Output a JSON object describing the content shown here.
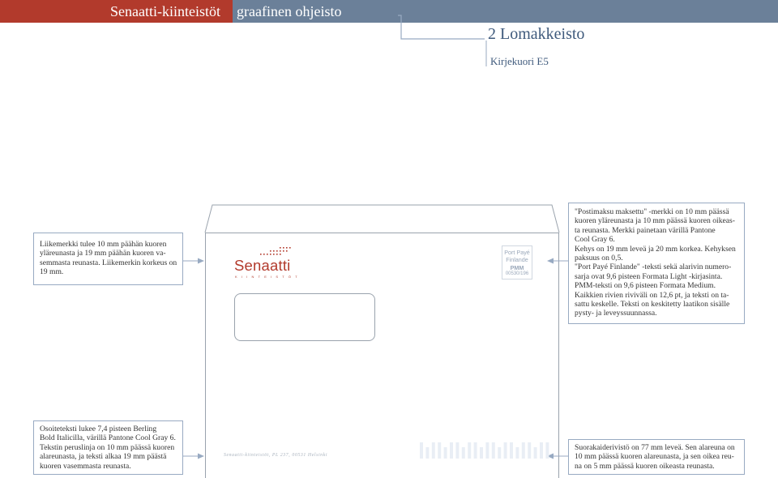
{
  "header": {
    "title_brand": "Senaatti-kiinteistöt",
    "title_rest": "graafinen ohjeisto",
    "colors": {
      "red": "#b23a2c",
      "blue": "#6b8099"
    }
  },
  "section": {
    "title": "2 Lomakkeisto",
    "subtitle": "Kirjekuori E5"
  },
  "annotations": {
    "logo": {
      "lines": [
        "Liikemerkki tulee 10 mm päähän kuoren",
        "yläreunasta ja 19 mm päähän kuoren va-",
        "semmasta reunasta. Liikemerkin korkeus on",
        "19 mm."
      ]
    },
    "postage": {
      "lines": [
        "\"Postimaksu maksettu\" -merkki on 10 mm päässä",
        "kuoren yläreunasta ja 10 mm päässä kuoren oikeas-",
        "ta reunasta.  Merkki painetaan värillä Pantone",
        "Cool Gray 6.",
        "Kehys on 19 mm leveä ja 20 mm korkea. Kehyksen",
        "paksuus on 0,5.",
        "\"Port Payé Finlande\" -teksti sekä alarivin numero-",
        "sarja ovat 9,6 pisteen Formata Light -kirjasinta.",
        "PMM-teksti on 9,6 pisteen Formata Medium.",
        "Kaikkien rivien riviväli on 12,6 pt, ja teksti on ta-",
        "sattu keskelle. Teksti on keskitetty laatikon sisälle",
        "pysty- ja leveyssuunnassa."
      ]
    },
    "address": {
      "lines": [
        "Osoiteteksti lukee 7,4 pisteen Berling",
        "Bold Italicilla, värillä Pantone Cool Gray 6.",
        "Tekstin peruslinja on 10 mm päässä kuoren",
        "alareunasta, ja teksti alkaa 19 mm päästä",
        "kuoren vasemmasta reunasta."
      ]
    },
    "barcode": {
      "lines": [
        "Suorakaiderivistö on 77 mm leveä. Sen alareuna on",
        "10 mm päässä kuoren alareunasta, ja sen oikea reu-",
        "na on 5 mm päässä kuoren oikeasta reunasta."
      ]
    }
  },
  "envelope": {
    "logo": {
      "name": "Senaatti",
      "subline": "KIINTEISTÖT"
    },
    "postage_mark": {
      "line1": "Port Payé",
      "line2": "Finlande",
      "line3": "PMM",
      "line4": "00530/196"
    },
    "footer_address": "Senaatti-kiinteistöt, PL 237, 00531 Helsinki",
    "barcode_color": "#e9eef5"
  }
}
